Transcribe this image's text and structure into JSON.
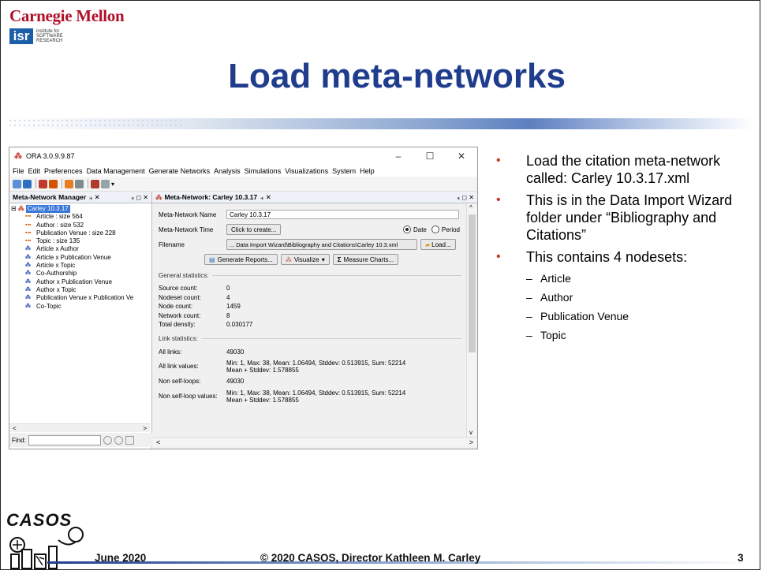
{
  "header": {
    "cmu": "Carnegie Mellon",
    "isr_box": "isr",
    "isr_lines": [
      "institute for",
      "SOFTWARE",
      "RESEARCH"
    ],
    "title": "Load meta-networks"
  },
  "ora": {
    "window_title": "ORA 3.0.9.9.87",
    "win_min": "–",
    "win_max": "☐",
    "win_close": "✕",
    "menu": [
      "File",
      "Edit",
      "Preferences",
      "Data Management",
      "Generate Networks",
      "Analysis",
      "Simulations",
      "Visualizations",
      "System",
      "Help"
    ],
    "left_tab": "Meta-Network Manager",
    "left_tab_ctl": "⁎ ✕",
    "left_tab_ctl2": "⁎ ◻ ✕",
    "tree_root": "Carley 10.3.17",
    "tree_nodes": [
      {
        "label": "Article : size 564",
        "type": "nodeset"
      },
      {
        "label": "Author : size 532",
        "type": "nodeset"
      },
      {
        "label": "Publication Venue : size 228",
        "type": "nodeset"
      },
      {
        "label": "Topic : size 135",
        "type": "nodeset"
      },
      {
        "label": "Article x Author",
        "type": "network"
      },
      {
        "label": "Article x Publication Venue",
        "type": "network"
      },
      {
        "label": "Article x Topic",
        "type": "network"
      },
      {
        "label": "Co-Authorship",
        "type": "network"
      },
      {
        "label": "Author x Publication Venue",
        "type": "network"
      },
      {
        "label": "Author x Topic",
        "type": "network"
      },
      {
        "label": "Publication Venue x Publication Ve",
        "type": "network"
      },
      {
        "label": "Co-Topic",
        "type": "network"
      }
    ],
    "find_label": "Find:",
    "right_tab": "Meta-Network: Carley 10.3.17",
    "right_tab_ctl": "⁎ ✕",
    "right_tab_ctl2": "⁎ ◻ ✕",
    "mn_name_label": "Meta-Network Name",
    "mn_name_value": "Carley 10.3.17",
    "mn_time_label": "Meta-Network Time",
    "click_to_create": "Click to create...",
    "radio_date": "Date",
    "radio_period": "Period",
    "filename_label": "Filename",
    "filename_value": "... Data Import Wizard\\Bibliography and Citations\\Carley 10.3.xml",
    "load_button": "Load...",
    "generate_reports": "Generate Reports...",
    "visualize": "Visualize",
    "measure_charts": "Measure Charts...",
    "general_stats_header": "General statistics:",
    "general_stats": [
      {
        "k": "Source count:",
        "v": "0"
      },
      {
        "k": "Nodeset count:",
        "v": "4"
      },
      {
        "k": "Node count:",
        "v": "1459"
      },
      {
        "k": "Network count:",
        "v": "8"
      },
      {
        "k": "Total density:",
        "v": "0.030177"
      }
    ],
    "link_stats_header": "Link statistics:",
    "all_links_label": "All links:",
    "all_links_value": "49030",
    "all_link_values_label": "All link values:",
    "all_link_values_l1": "Min: 1, Max: 38, Mean: 1.06494, Stddev: 0.513915, Sum: 52214",
    "all_link_values_l2": "Mean + Stddev: 1.578855",
    "non_self_loops_label": "Non self-loops:",
    "non_self_loops_value": "49030",
    "non_self_loop_values_label": "Non self-loop values:",
    "non_self_loop_values_l1": "Min: 1, Max: 38, Mean: 1.06494, Stddev: 0.513915, Sum: 52214",
    "non_self_loop_values_l2": "Mean + Stddev: 1.578855"
  },
  "bullets": {
    "b1": "Load the citation  meta-network called: Carley 10.3.17.xml",
    "b2": "This is in the Data Import Wizard folder under “Bibliography and Citations”",
    "b3": "This contains 4 nodesets:",
    "subs": [
      "Article",
      "Author",
      "Publication Venue",
      "Topic"
    ]
  },
  "footer": {
    "date": "June 2020",
    "copyright": "© 2020 CASOS, Director Kathleen M. Carley",
    "page": "3",
    "logo_text": "CASOS"
  }
}
